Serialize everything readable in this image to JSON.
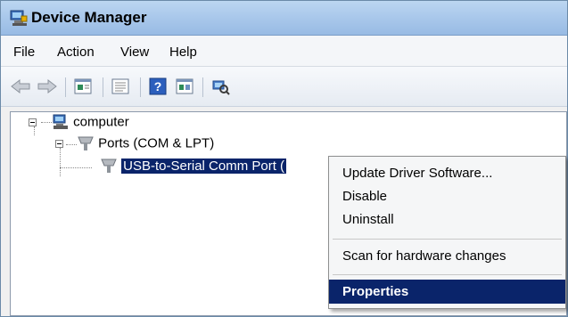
{
  "window": {
    "title": "Device Manager"
  },
  "menubar": {
    "items": [
      "File",
      "Action",
      "View",
      "Help"
    ]
  },
  "toolbar": {
    "buttons": [
      "back-arrow-icon",
      "forward-arrow-icon",
      "properties-icon",
      "view-icon",
      "help-icon",
      "update-driver-icon",
      "scan-hardware-icon"
    ]
  },
  "tree": {
    "root": "computer",
    "ports": "Ports (COM & LPT)",
    "device": "USB-to-Serial Comm Port ("
  },
  "context_menu": {
    "items": [
      "Update Driver Software...",
      "Disable",
      "Uninstall",
      "Scan for hardware changes",
      "Properties"
    ],
    "highlighted": "Properties"
  },
  "colors": {
    "selection": "#0a246a",
    "titlebar": "#a7c6ea"
  }
}
